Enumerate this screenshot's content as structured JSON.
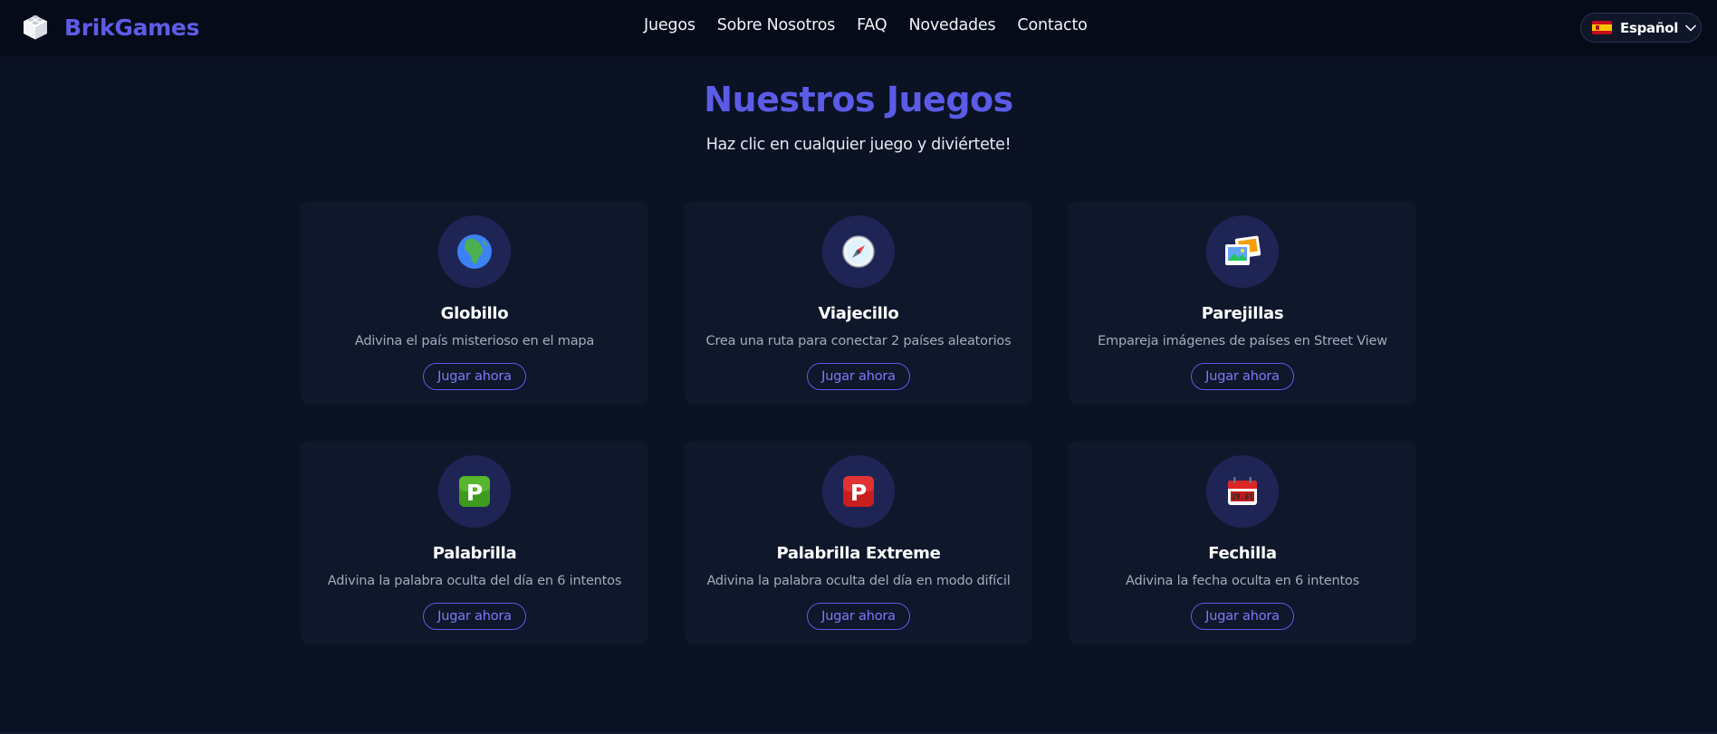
{
  "header": {
    "brand": "BrikGames",
    "nav": [
      "Juegos",
      "Sobre Nosotros",
      "FAQ",
      "Novedades",
      "Contacto"
    ],
    "language": "Español",
    "language_flag": "spain-flag-icon"
  },
  "main": {
    "title": "Nuestros Juegos",
    "subtitle": "Haz clic en cualquier juego y diviértete!"
  },
  "games": [
    {
      "icon": "globe-africa-icon",
      "name": "Globillo",
      "desc": "Adivina el país misterioso en el mapa",
      "cta": "Jugar ahora"
    },
    {
      "icon": "compass-icon",
      "name": "Viajecillo",
      "desc": "Crea una ruta para conectar 2 países aleatorios",
      "cta": "Jugar ahora"
    },
    {
      "icon": "photos-icon",
      "name": "Parejillas",
      "desc": "Empareja imágenes de países en Street View",
      "cta": "Jugar ahora"
    },
    {
      "icon": "green-p-button-icon",
      "name": "Palabrilla",
      "desc": "Adivina la palabra oculta del día en 6 intentos",
      "cta": "Jugar ahora"
    },
    {
      "icon": "red-p-button-icon",
      "name": "Palabrilla Extreme",
      "desc": "Adivina la palabra oculta del día en modo difícil",
      "cta": "Jugar ahora"
    },
    {
      "icon": "calendar-icon",
      "name": "Fechilla",
      "desc": "Adivina la fecha oculta en 6 intentos",
      "cta": "Jugar ahora",
      "icon_text": "29.01"
    }
  ],
  "colors": {
    "background": "#0b1224",
    "header": "#060b1a",
    "accent": "#5b5be8",
    "card": "#0f172b",
    "icon_circle": "#1e2555"
  }
}
